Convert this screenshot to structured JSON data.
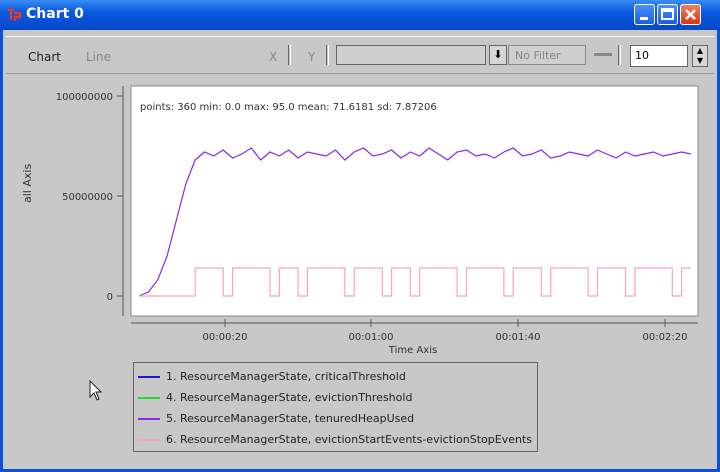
{
  "window": {
    "title": "Chart 0"
  },
  "toolbar": {
    "chart_label": "Chart",
    "type_label": "Line",
    "x_label": "X",
    "y_label": "Y",
    "y_value": "",
    "filter_label": "No Filter",
    "spinner_value": "10"
  },
  "plot": {
    "stats_text": "points: 360 min: 0.0 max: 95.0 mean: 71.6181 sd: 7.87206",
    "x_axis_title": "Time Axis",
    "y_axis_title": "all Axis",
    "y_ticks": [
      "100000000",
      "50000000",
      "0"
    ],
    "x_ticks": [
      "00:00:20",
      "00:01:00",
      "00:01:40",
      "00:02:20"
    ]
  },
  "legend": {
    "items": [
      {
        "label": "1.  ResourceManagerState, criticalThreshold",
        "color": "#1a1acc"
      },
      {
        "label": "4.  ResourceManagerState, evictionThreshold",
        "color": "#22dd22"
      },
      {
        "label": "5.  ResourceManagerState, tenuredHeapUsed",
        "color": "#8a28e8"
      },
      {
        "label": "6.  ResourceManagerState, evictionStartEvents-evictionStopEvents",
        "color": "#f4a8b8"
      }
    ]
  },
  "chart_data": {
    "type": "line",
    "ylim": [
      0,
      100000000
    ],
    "series": [
      {
        "name": "1.  ResourceManagerState, criticalThreshold",
        "values": []
      },
      {
        "name": "4.  ResourceManagerState, evictionThreshold",
        "values": []
      },
      {
        "name": "5.  ResourceManagerState, tenuredHeapUsed",
        "values": [
          0,
          2000000,
          8000000,
          20000000,
          38000000,
          56000000,
          68000000,
          72000000,
          70000000,
          73000000,
          69000000,
          71000000,
          74000000,
          68000000,
          72000000,
          70000000,
          73000000,
          69000000,
          72000000,
          71000000,
          70000000,
          73000000,
          68000000,
          72000000,
          74000000,
          70000000,
          71000000,
          73000000,
          69000000,
          72000000,
          70000000,
          74000000,
          71000000,
          68000000,
          72000000,
          73000000,
          70000000,
          71000000,
          69000000,
          72000000,
          74000000,
          70000000,
          71000000,
          73000000,
          69000000,
          70000000,
          72000000,
          71000000,
          70000000,
          73000000,
          71000000,
          69000000,
          72000000,
          70000000,
          71000000,
          72000000,
          70000000,
          71000000,
          72000000,
          71000000
        ]
      },
      {
        "name": "6.  ResourceManagerState, evictionStartEvents-evictionStopEvents",
        "values": [
          0,
          0,
          0,
          0,
          0,
          0,
          14000000,
          14000000,
          14000000,
          0,
          14000000,
          14000000,
          14000000,
          14000000,
          0,
          14000000,
          14000000,
          0,
          14000000,
          14000000,
          14000000,
          14000000,
          0,
          14000000,
          14000000,
          14000000,
          0,
          14000000,
          14000000,
          0,
          14000000,
          14000000,
          14000000,
          14000000,
          0,
          14000000,
          14000000,
          14000000,
          14000000,
          0,
          14000000,
          14000000,
          14000000,
          0,
          14000000,
          14000000,
          14000000,
          14000000,
          0,
          14000000,
          14000000,
          14000000,
          0,
          14000000,
          14000000,
          14000000,
          14000000,
          0,
          14000000,
          14000000
        ]
      }
    ]
  }
}
